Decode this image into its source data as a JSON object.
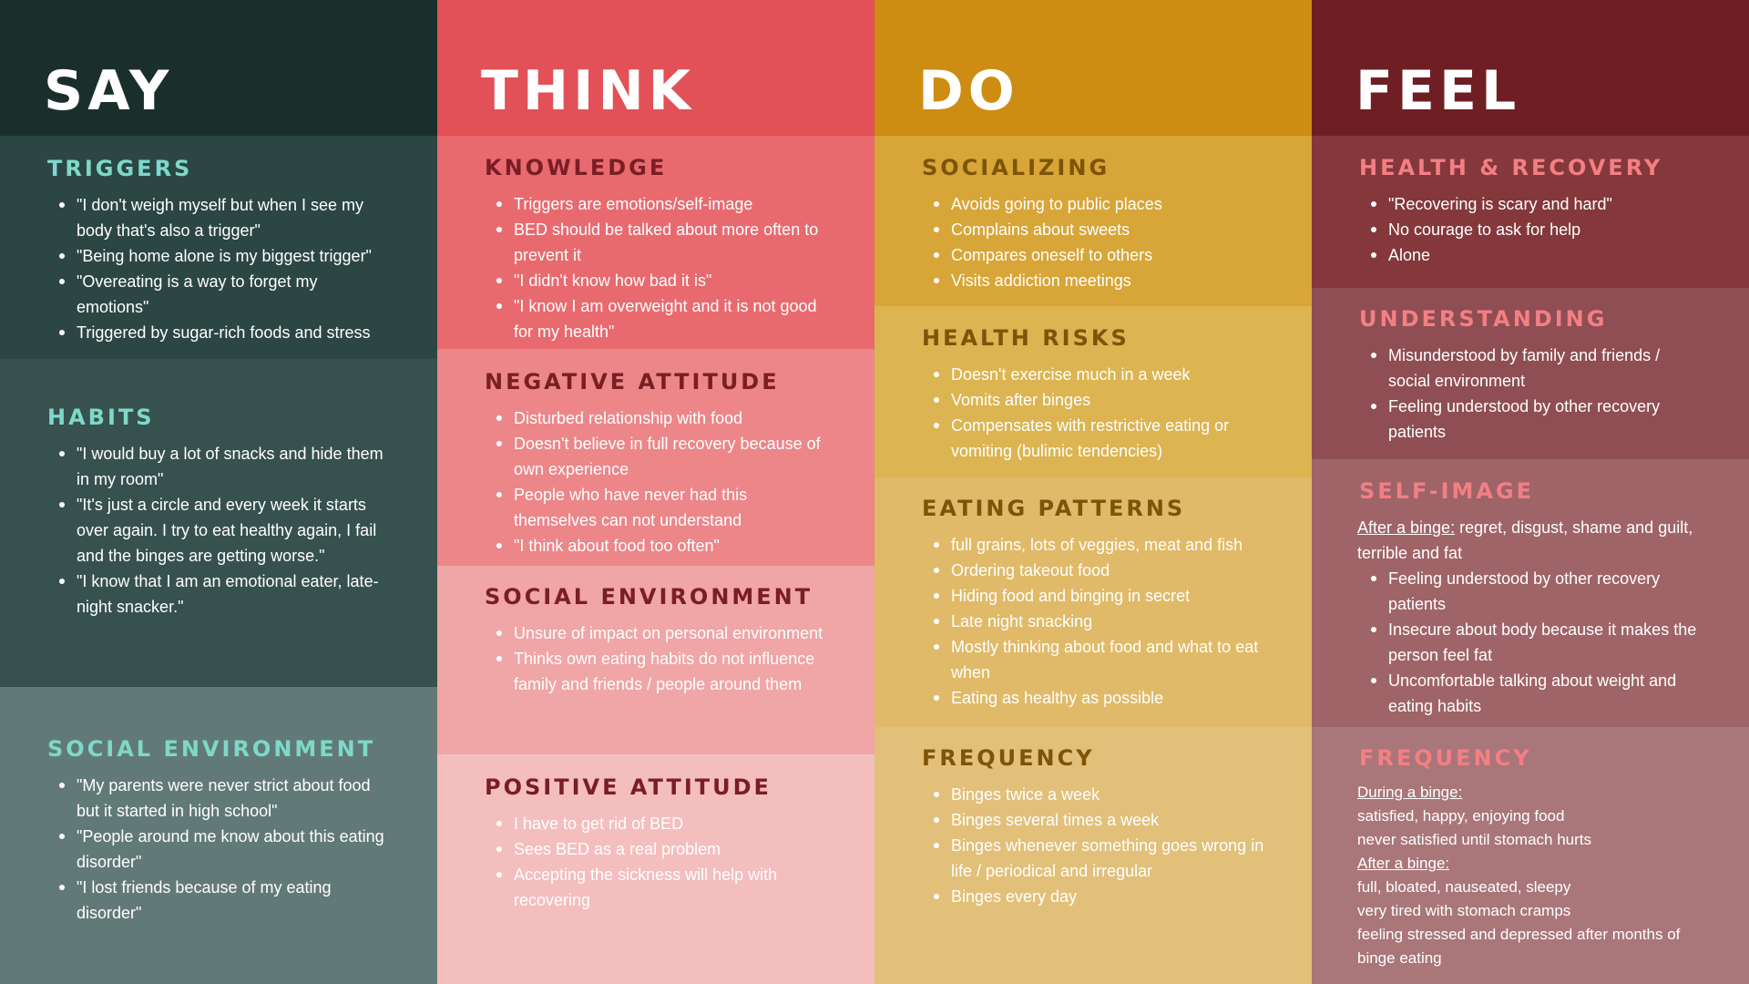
{
  "colors": {
    "say": [
      "#1a2f2c",
      "#2c4643",
      "#37514e",
      "#627a77"
    ],
    "think": [
      "#e25157",
      "#e86a6f",
      "#ec8689",
      "#f0a5a6",
      "#f4bebf"
    ],
    "do": [
      "#cd8c12",
      "#d8a538",
      "#dcb451",
      "#e0ba68",
      "#e2c07a"
    ],
    "feel": [
      "#6f1f23",
      "#84383c",
      "#8f4e53",
      "#9f6468",
      "#a9767a"
    ],
    "say_title": "#7dd9c9",
    "think_title": "#7a1e24",
    "do_title": "#7d5408",
    "feel_title": "#f37f84"
  },
  "say": {
    "title": "SAY",
    "triggers": {
      "title": "TRIGGERS",
      "items": [
        "\"I don't weigh myself but when I see my body that's also a trigger\"",
        "\"Being home alone is my biggest trigger\"",
        "\"Overeating is a way to forget my emotions\"",
        "Triggered by sugar-rich foods and stress"
      ]
    },
    "habits": {
      "title": "HABITS",
      "items": [
        "\"I would buy a lot of snacks and hide them in my room\"",
        "\"It's just a circle and every week it starts over again. I try to eat healthy again, I fail and the binges are getting worse.\"",
        "\"I know that I am an emotional eater, late-night snacker.\""
      ]
    },
    "social": {
      "title": "SOCIAL ENVIRONMENT",
      "items": [
        "\"My parents were never strict about food but it started in high school\"",
        "\"People around me know about this eating disorder\"",
        "\"I lost friends because of my eating disorder\""
      ]
    }
  },
  "think": {
    "title": "THINK",
    "knowledge": {
      "title": "KNOWLEDGE",
      "items": [
        "Triggers are emotions/self-image",
        "BED should be talked about more often to prevent it",
        "\"I didn't know how bad it is\"",
        "\"I know I am overweight and it is not good for my health\""
      ]
    },
    "negative": {
      "title": "NEGATIVE ATTITUDE",
      "items": [
        "Disturbed relationship with food",
        "Doesn't believe in full recovery because of own experience",
        "People who have never had this themselves can not understand",
        "\"I think about food too often\""
      ]
    },
    "social": {
      "title": "SOCIAL ENVIRONMENT",
      "items": [
        "Unsure of impact on personal environment",
        "Thinks own eating habits do not influence family and friends / people around them"
      ]
    },
    "positive": {
      "title": "POSITIVE ATTITUDE",
      "items": [
        "I have to get rid of BED",
        "Sees BED as a real problem",
        "Accepting the sickness will help with recovering"
      ]
    }
  },
  "do": {
    "title": "DO",
    "socializing": {
      "title": "SOCIALIZING",
      "items": [
        "Avoids going to public places",
        "Complains about sweets",
        "Compares oneself to others",
        "Visits addiction meetings"
      ]
    },
    "health": {
      "title": "HEALTH RISKS",
      "items": [
        "Doesn't exercise much in a week",
        "Vomits after binges",
        "Compensates with restrictive eating or vomiting (bulimic tendencies)"
      ]
    },
    "eating": {
      "title": "EATING PATTERNS",
      "items": [
        "full grains, lots of veggies, meat and fish",
        "Ordering takeout food",
        "Hiding food and binging in secret",
        "Late night snacking",
        "Mostly thinking about food and what to eat when",
        "Eating as healthy as possible"
      ]
    },
    "frequency": {
      "title": "FREQUENCY",
      "items": [
        "Binges twice a week",
        "Binges several times a week",
        "Binges whenever something goes wrong in life / periodical and irregular",
        "Binges every day"
      ]
    }
  },
  "feel": {
    "title": "FEEL",
    "health": {
      "title": "HEALTH & RECOVERY",
      "items": [
        "\"Recovering is scary and hard\"",
        "No courage to ask for help",
        "Alone"
      ]
    },
    "understanding": {
      "title": "UNDERSTANDING",
      "items": [
        "Misunderstood by family and friends / social environment",
        "Feeling understood by other recovery patients"
      ]
    },
    "selfimage": {
      "title": "SELF-IMAGE",
      "after_label": "After a binge:",
      "after_text": " regret, disgust, shame and guilt, terrible and fat",
      "items": [
        "Feeling understood by other recovery patients",
        "Insecure about body because it makes the person feel fat",
        "Uncomfortable talking about weight and eating habits"
      ]
    },
    "frequency": {
      "title": "FREQUENCY",
      "during_label": "During a binge:",
      "during_lines": [
        "satisfied, happy, enjoying food",
        "never satisfied until stomach hurts"
      ],
      "after_label": "After a binge:",
      "after_lines": [
        "full, bloated, nauseated, sleepy",
        "very tired with stomach cramps",
        "feeling stressed and depressed after months of binge eating"
      ]
    }
  }
}
